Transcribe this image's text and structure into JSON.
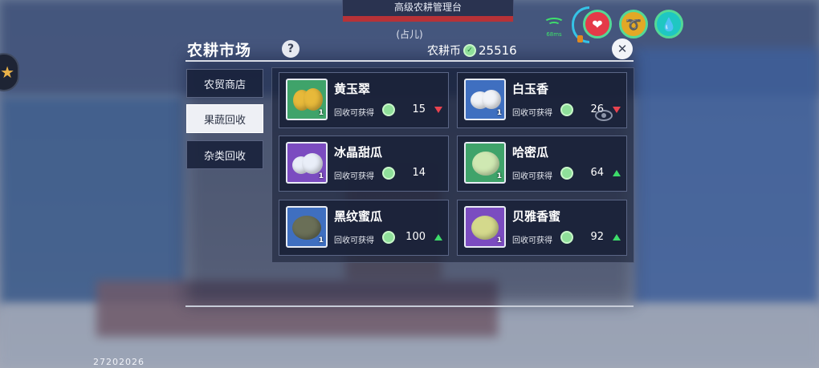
{
  "hud": {
    "banner_title": "高级农耕管理台",
    "sub_tag": "(占儿)",
    "ping": "68ms",
    "icons": [
      "heart-icon",
      "food-icon",
      "water-drop-icon"
    ]
  },
  "panel": {
    "title": "农耕市场",
    "help_label": "?",
    "currency_label": "农耕币",
    "currency_value": "25516",
    "close_label": "✕"
  },
  "tabs": [
    {
      "label": "农贸商店",
      "active": false
    },
    {
      "label": "果蔬回收",
      "active": true
    },
    {
      "label": "杂类回收",
      "active": false
    }
  ],
  "items": [
    {
      "name": "黄玉翠",
      "receive_label": "回收可获得",
      "price": "15",
      "trend": "down",
      "thumb_bg": "#3fa36a",
      "fruit_color": "#e7b93a",
      "level": "1"
    },
    {
      "name": "白玉香",
      "receive_label": "回收可获得",
      "price": "26",
      "trend": "down",
      "thumb_bg": "#3f6fc0",
      "fruit_color": "#f1f3f8",
      "level": "1"
    },
    {
      "name": "冰晶甜瓜",
      "receive_label": "回收可获得",
      "price": "14",
      "trend": "none",
      "thumb_bg": "#7b4cc0",
      "fruit_color": "#e9eef8",
      "level": "1"
    },
    {
      "name": "哈密瓜",
      "receive_label": "回收可获得",
      "price": "64",
      "trend": "up",
      "thumb_bg": "#3fa36a",
      "fruit_color": "#cfe8b2",
      "level": "1"
    },
    {
      "name": "黑纹蜜瓜",
      "receive_label": "回收可获得",
      "price": "100",
      "trend": "up",
      "thumb_bg": "#3f6fc0",
      "fruit_color": "#6a6f57",
      "level": "1"
    },
    {
      "name": "贝雅香蜜",
      "receive_label": "回收可获得",
      "price": "92",
      "trend": "up",
      "thumb_bg": "#7b4cc0",
      "fruit_color": "#d4d98c",
      "level": "1"
    }
  ],
  "footer": {
    "id": "27202026"
  }
}
